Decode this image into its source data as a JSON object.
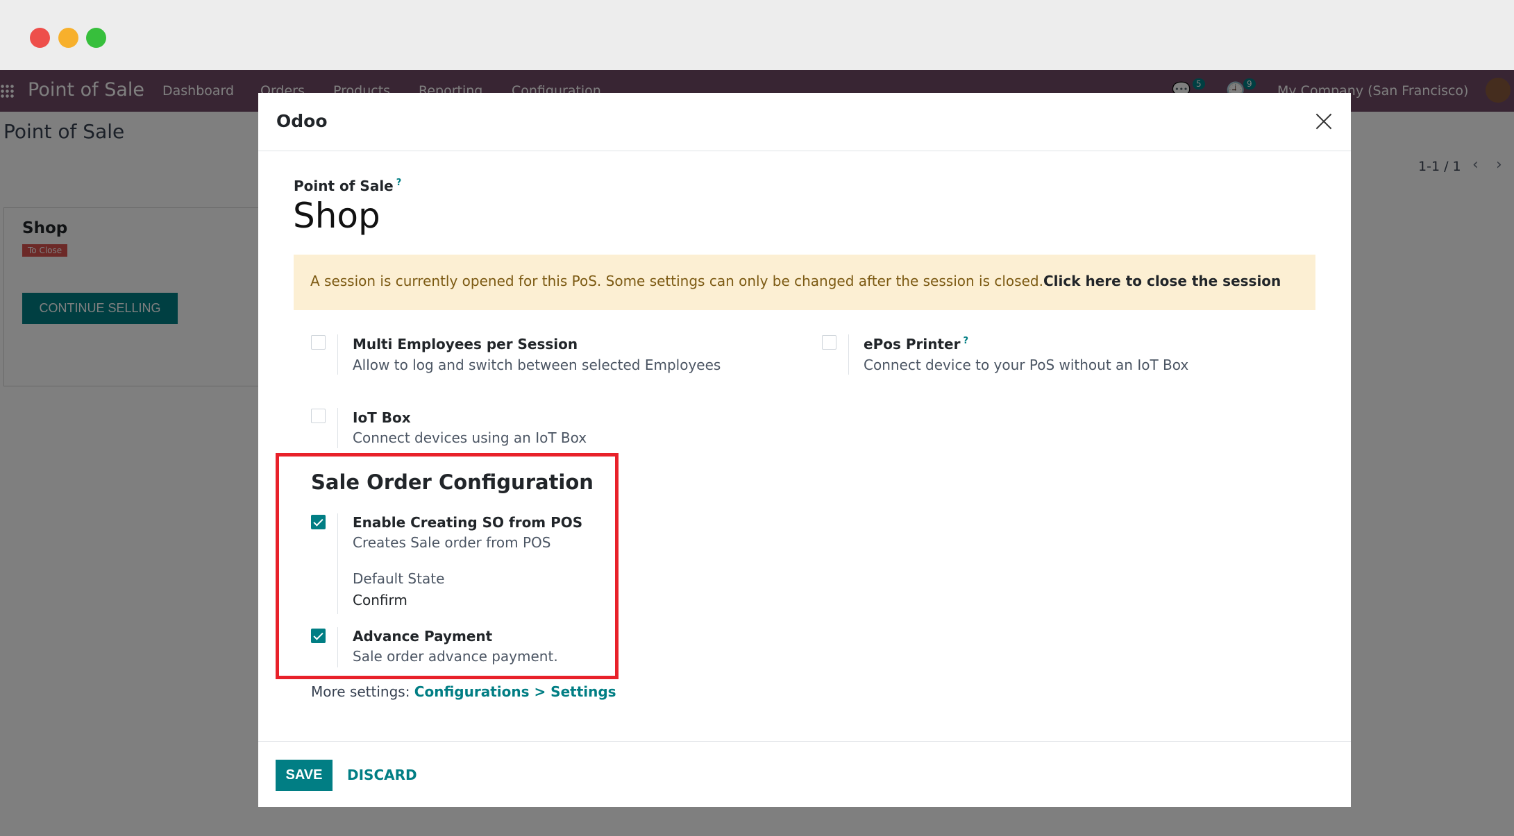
{
  "window": {
    "controls": [
      "close",
      "minimize",
      "maximize"
    ]
  },
  "navbar": {
    "app_name": "Point of Sale",
    "menu": [
      "Dashboard",
      "Orders",
      "Products",
      "Reporting",
      "Configuration"
    ],
    "messages_count": "5",
    "activities_count": "9",
    "company": "My Company (San Francisco)"
  },
  "control_panel": {
    "title": "Point of Sale",
    "pager": "1-1 / 1"
  },
  "kanban": {
    "card_title": "Shop",
    "status_badge": "To Close",
    "continue_button": "CONTINUE SELLING"
  },
  "modal": {
    "title": "Odoo",
    "field_label": "Point of Sale",
    "help_mark": "?",
    "record_name": "Shop",
    "alert": {
      "text": "A session is currently opened for this PoS. Some settings can only be changed after the session is closed.",
      "link": "Click here to close the session"
    },
    "settings": {
      "multi_employees": {
        "title": "Multi Employees per Session",
        "desc": "Allow to log and switch between selected Employees",
        "checked": false
      },
      "epos_printer": {
        "title": "ePos Printer",
        "desc": "Connect device to your PoS without an IoT Box",
        "checked": false
      },
      "iot_box": {
        "title": "IoT Box",
        "desc": "Connect devices using an IoT Box",
        "checked": false
      }
    },
    "sale_order_section": {
      "title": "Sale Order Configuration",
      "enable_so": {
        "title": "Enable Creating SO from POS",
        "desc": "Creates Sale order from POS",
        "checked": true
      },
      "default_state_label": "Default State",
      "default_state_value": "Confirm",
      "advance_payment": {
        "title": "Advance Payment",
        "desc": "Sale order advance payment.",
        "checked": true
      }
    },
    "more_settings": {
      "prefix": "More settings: ",
      "link": "Configurations > Settings"
    },
    "footer": {
      "save": "SAVE",
      "discard": "DISCARD"
    }
  },
  "colors": {
    "brand": "#714b67",
    "accent": "#017e84",
    "highlight_box": "#e8212a",
    "alert_bg": "#fcefd3"
  }
}
